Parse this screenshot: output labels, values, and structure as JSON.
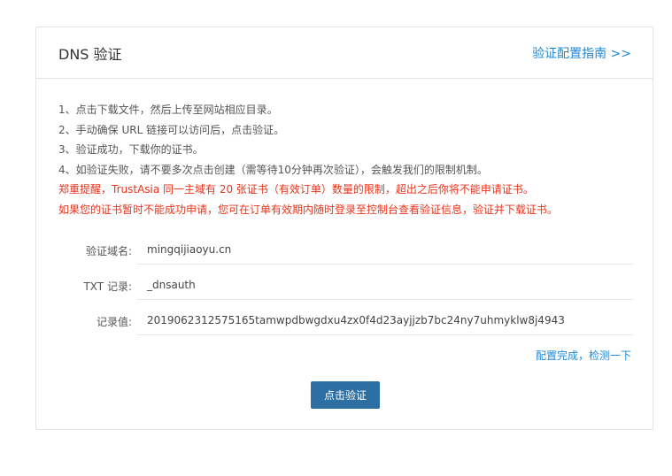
{
  "panel": {
    "title": "DNS 验证",
    "guide_link": "验证配置指南 >>"
  },
  "instructions": [
    "1、点击下载文件，然后上传至网站相应目录。",
    "2、手动确保 URL 链接可以访问后，点击验证。",
    "3、验证成功，下载你的证书。",
    "4、如验证失败，请不要多次点击创建（需等待10分钟再次验证），会触发我们的限制机制。"
  ],
  "warnings": [
    "郑重提醒，TrustAsia 同一主域有 20 张证书（有效订单）数量的限制，超出之后你将不能申请证书。",
    "如果您的证书暂时不能成功申请，您可在订单有效期内随时登录至控制台查看验证信息，验证并下载证书。"
  ],
  "fields": [
    {
      "label": "验证域名:",
      "value": "mingqijiaoyu.cn"
    },
    {
      "label": "TXT 记录:",
      "value": "_dnsauth"
    },
    {
      "label": "记录值:",
      "value": "2019062312575165tamwpdbwgdxu4zx0f4d23ayjjzb7bc24ny7uhmyklw8j4943"
    }
  ],
  "check_link": "配置完成，检测一下",
  "verify_button": "点击验证",
  "colors": {
    "link": "#1e88d6",
    "warning": "#e8341c",
    "button": "#2d6fa3"
  }
}
